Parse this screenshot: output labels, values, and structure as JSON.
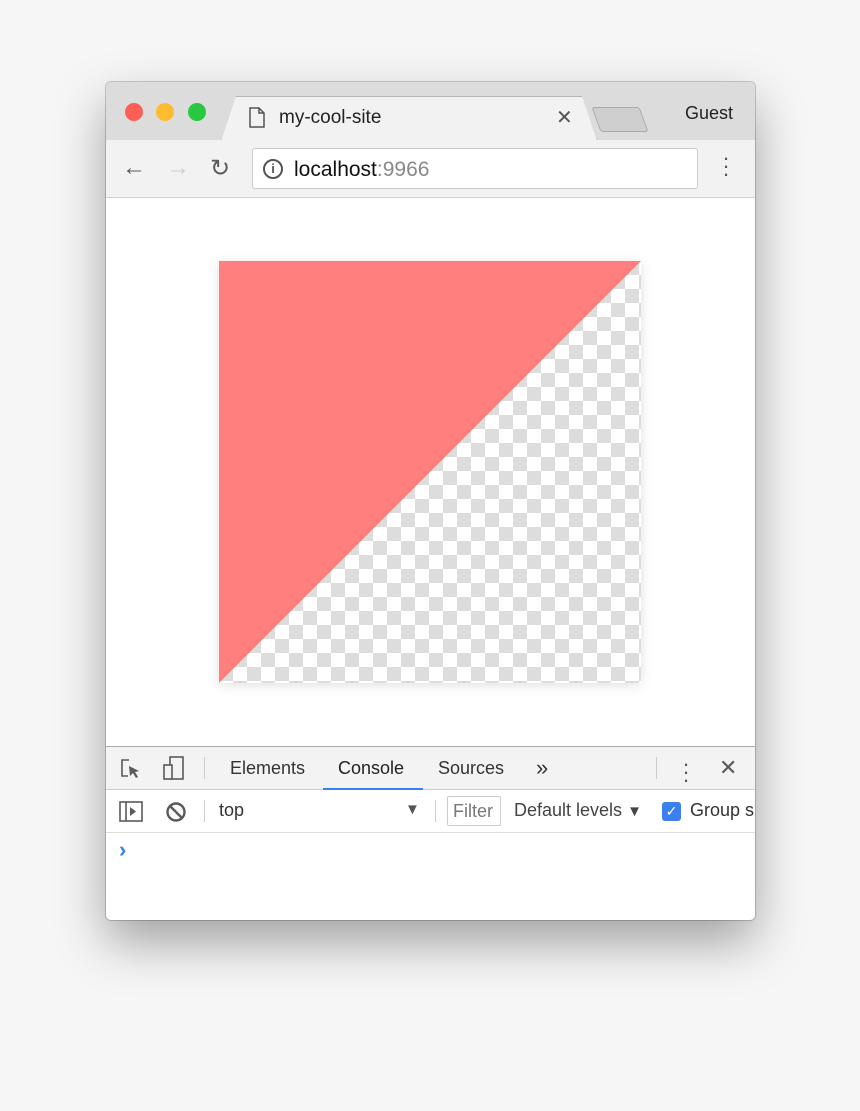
{
  "browser": {
    "tab_title": "my-cool-site",
    "profile": "Guest",
    "url_host": "localhost",
    "url_port": ":9966",
    "traffic_colors": [
      "#fd5f57",
      "#febc2e",
      "#28c840"
    ]
  },
  "page": {
    "canvas": {
      "fill_color": "#ff7f7f",
      "shape": "triangle-top-left",
      "background": "transparent-checkerboard"
    }
  },
  "devtools": {
    "tabs": [
      {
        "label": "Elements"
      },
      {
        "label": "Console",
        "active": true
      },
      {
        "label": "Sources"
      }
    ],
    "more": "»",
    "context": "top",
    "filter_placeholder": "Filter",
    "levels": "Default levels",
    "group_label": "Group s",
    "group_checked": true,
    "prompt": "›",
    "accent": "#3b80ee"
  }
}
